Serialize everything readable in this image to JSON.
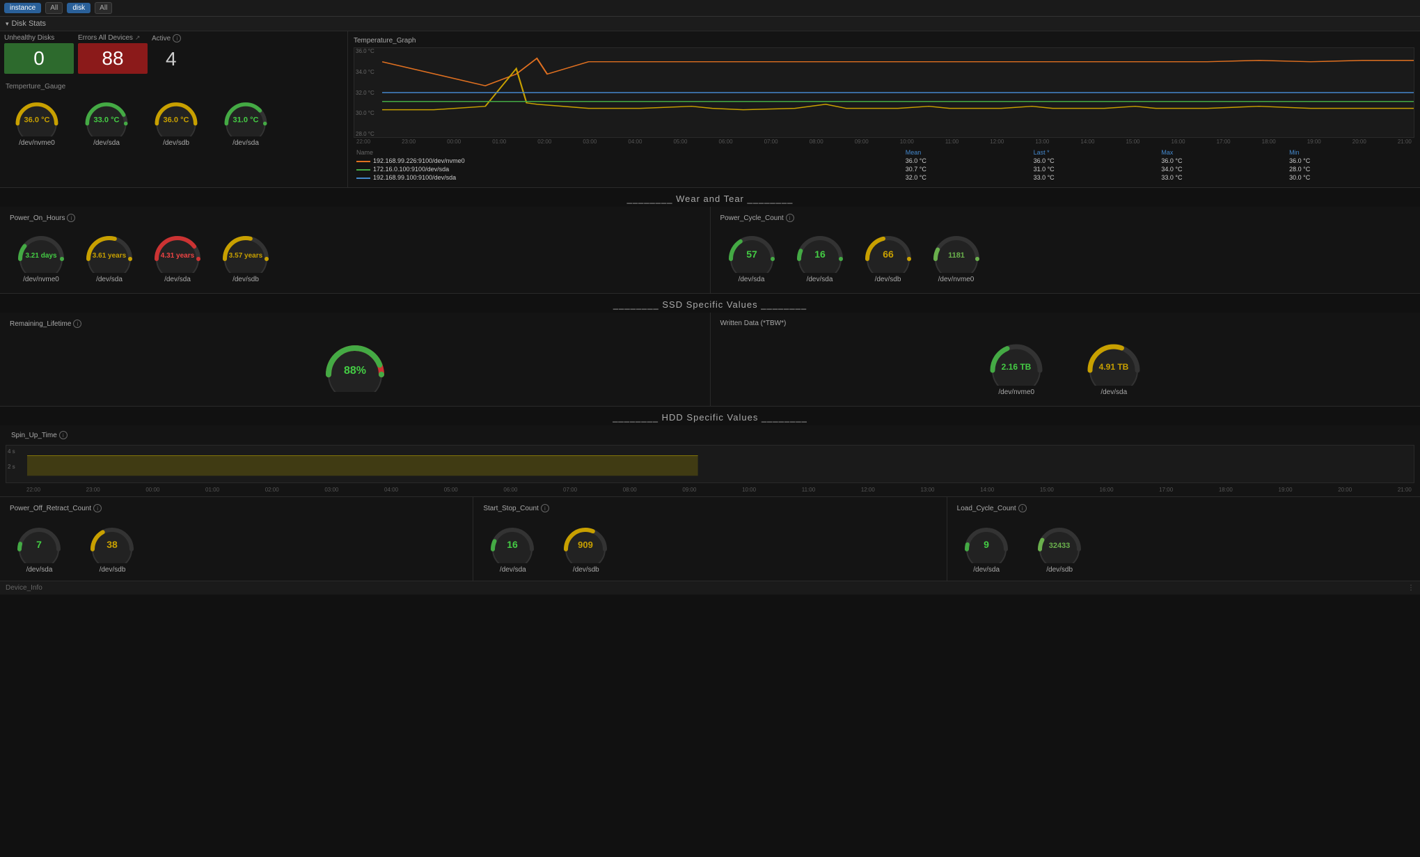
{
  "topbar": {
    "instance_label": "instance",
    "all_label1": "All",
    "disk_label": "disk",
    "all_label2": "All"
  },
  "disk_stats": {
    "section_title": "Disk Stats",
    "unhealthy_disks": {
      "label": "Unhealthy Disks",
      "value": "0",
      "color": "green"
    },
    "errors_all_devices": {
      "label": "Errors All Devices",
      "value": "88",
      "color": "red"
    },
    "active": {
      "label": "Active",
      "value": "4"
    }
  },
  "temperature_gauge": {
    "section_label": "Temperture_Gauge",
    "gauges": [
      {
        "value": "36.0 °C",
        "label": "/dev/nvme0",
        "color": "yellow"
      },
      {
        "value": "33.0 °C",
        "label": "/dev/sda",
        "color": "green"
      },
      {
        "value": "36.0 °C",
        "label": "/dev/sdb",
        "color": "yellow"
      },
      {
        "value": "31.0 °C",
        "label": "/dev/sda",
        "color": "green"
      }
    ]
  },
  "temperature_graph": {
    "title": "Temperature_Graph",
    "y_labels": [
      "36.0 °C",
      "34.0 °C",
      "32.0 °C",
      "30.0 °C",
      "28.0 °C"
    ],
    "time_labels": [
      "22:00",
      "23:00",
      "00:00",
      "01:00",
      "02:00",
      "03:00",
      "04:00",
      "05:00",
      "06:00",
      "07:00",
      "08:00",
      "09:00",
      "10:00",
      "11:00",
      "12:00",
      "13:00",
      "14:00",
      "15:00",
      "16:00",
      "17:00",
      "18:00",
      "19:00",
      "20:00",
      "21:00"
    ],
    "legend": {
      "headers": [
        "Name",
        "Mean",
        "Last *",
        "Max",
        "Min"
      ],
      "rows": [
        {
          "color": "#e07020",
          "name": "192.168.99.226:9100/dev/nvme0",
          "mean": "36.0 °C",
          "last": "36.0 °C",
          "max": "36.0 °C",
          "min": "36.0 °C"
        },
        {
          "color": "#3a3",
          "name": "172.16.0.100:9100/dev/sda",
          "mean": "30.7 °C",
          "last": "31.0 °C",
          "max": "34.0 °C",
          "min": "28.0 °C"
        },
        {
          "color": "#4488cc",
          "name": "192.168.99.100:9100/dev/sda",
          "mean": "32.0 °C",
          "last": "33.0 °C",
          "max": "33.0 °C",
          "min": "30.0 °C"
        }
      ]
    }
  },
  "wear_and_tear": {
    "title": "Wear and Tear",
    "power_on_hours": {
      "label": "Power_On_Hours",
      "gauges": [
        {
          "value": "3.21 days",
          "label": "/dev/nvme0",
          "color": "green"
        },
        {
          "value": "3.61 years",
          "label": "/dev/sda",
          "color": "yellow"
        },
        {
          "value": "4.31 years",
          "label": "/dev/sda",
          "color": "red"
        },
        {
          "value": "3.57 years",
          "label": "/dev/sdb",
          "color": "yellow"
        }
      ]
    },
    "power_cycle_count": {
      "label": "Power_Cycle_Count",
      "gauges": [
        {
          "value": "57",
          "label": "/dev/sda",
          "color": "green"
        },
        {
          "value": "16",
          "label": "/dev/sda",
          "color": "green"
        },
        {
          "value": "66",
          "label": "/dev/sdb",
          "color": "yellow"
        },
        {
          "value": "1181",
          "label": "/dev/nvme0",
          "color": "green"
        }
      ]
    }
  },
  "ssd_specific": {
    "title": "SSD Specific Values",
    "remaining_lifetime": {
      "label": "Remaining_Lifetime",
      "gauges": [
        {
          "value": "88%",
          "label": "",
          "color": "green"
        }
      ]
    },
    "written_data": {
      "label": "Written Data (*TBW*)",
      "gauges": [
        {
          "value": "2.16 TB",
          "label": "/dev/nvme0",
          "color": "green"
        },
        {
          "value": "4.91 TB",
          "label": "/dev/sda",
          "color": "yellow"
        }
      ]
    }
  },
  "hdd_specific": {
    "title": "HDD Specific Values",
    "spin_up_time": {
      "label": "Spin_Up_Time",
      "y_labels": [
        "4 s",
        "2 s"
      ],
      "time_labels": [
        "22:00",
        "23:00",
        "00:00",
        "01:00",
        "02:00",
        "03:00",
        "04:00",
        "05:00",
        "06:00",
        "07:00",
        "08:00",
        "09:00",
        "10:00",
        "11:00",
        "12:00",
        "13:00",
        "14:00",
        "15:00",
        "16:00",
        "17:00",
        "18:00",
        "19:00",
        "20:00",
        "21:00"
      ]
    },
    "power_off_retract": {
      "label": "Power_Off_Retract_Count",
      "gauges": [
        {
          "value": "7",
          "label": "/dev/sda",
          "color": "green"
        },
        {
          "value": "38",
          "label": "/dev/sdb",
          "color": "yellow"
        }
      ]
    },
    "start_stop_count": {
      "label": "Start_Stop_Count",
      "gauges": [
        {
          "value": "16",
          "label": "/dev/sda",
          "color": "green"
        },
        {
          "value": "909",
          "label": "/dev/sdb",
          "color": "yellow"
        }
      ]
    },
    "load_cycle_count": {
      "label": "Load_Cycle_Count",
      "gauges": [
        {
          "value": "9",
          "label": "/dev/sda",
          "color": "green"
        },
        {
          "value": "32433",
          "label": "/dev/sdb",
          "color": "green"
        }
      ]
    }
  },
  "device_info": {
    "label": "Device_Info"
  }
}
